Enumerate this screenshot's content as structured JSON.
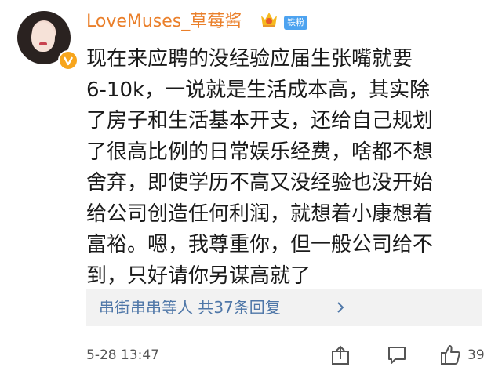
{
  "post": {
    "username": "LoveMuses_草莓酱",
    "fan_badge": "铁粉",
    "lines": [
      "现在来应聘的没经验应届生张嘴就要",
      "6-10k，一说就是生活成本高，其实除",
      "了房子和生活基本开支，还给自己规划",
      "了很高比例的日常娱乐经费，啥都不想",
      "舍弃，即使学历不高又没经验也没开始",
      "给公司创造任何利润，就想着小康想着",
      "富裕。嗯，我尊重你，但一般公司给不",
      "到，只好请你另谋高就了"
    ],
    "reply_summary": "串街串串等人 共37条回复",
    "timestamp": "5-28 13:47",
    "like_count": "39"
  },
  "icons": {
    "verified": "verified-badge-icon",
    "crown": "crown-level-icon",
    "chevron": "chevron-right-icon",
    "share": "share-icon",
    "comment": "comment-icon",
    "like": "thumbs-up-icon"
  },
  "colors": {
    "username": "#ea7f2a",
    "reply_link": "#4f77a8",
    "fan_badge_bg": "#4da3f0",
    "verified_bg": "#f7a51c"
  }
}
